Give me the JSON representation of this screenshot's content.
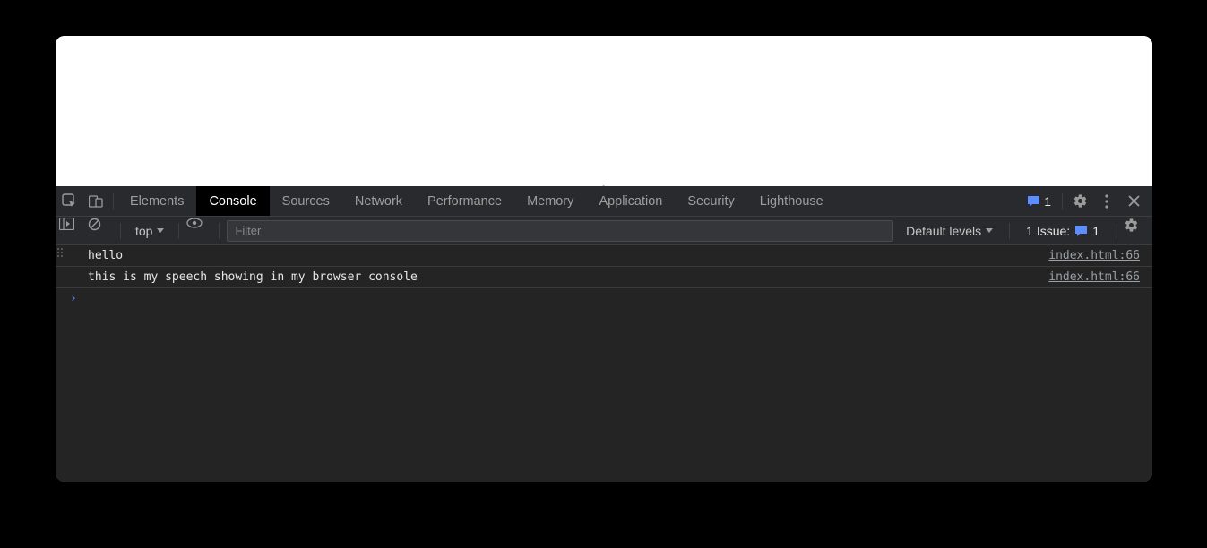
{
  "tabs": {
    "elements": "Elements",
    "console": "Console",
    "sources": "Sources",
    "network": "Network",
    "performance": "Performance",
    "memory": "Memory",
    "application": "Application",
    "security": "Security",
    "lighthouse": "Lighthouse"
  },
  "tabbar_issue_count": "1",
  "toolbar": {
    "context": "top",
    "filter_placeholder": "Filter",
    "levels_label": "Default levels",
    "issue_label": "1 Issue:",
    "issue_count": "1"
  },
  "logs": [
    {
      "message": "hello",
      "source": "index.html:66"
    },
    {
      "message": "this is my speech showing in my browser console",
      "source": "index.html:66"
    }
  ],
  "prompt_glyph": "›"
}
